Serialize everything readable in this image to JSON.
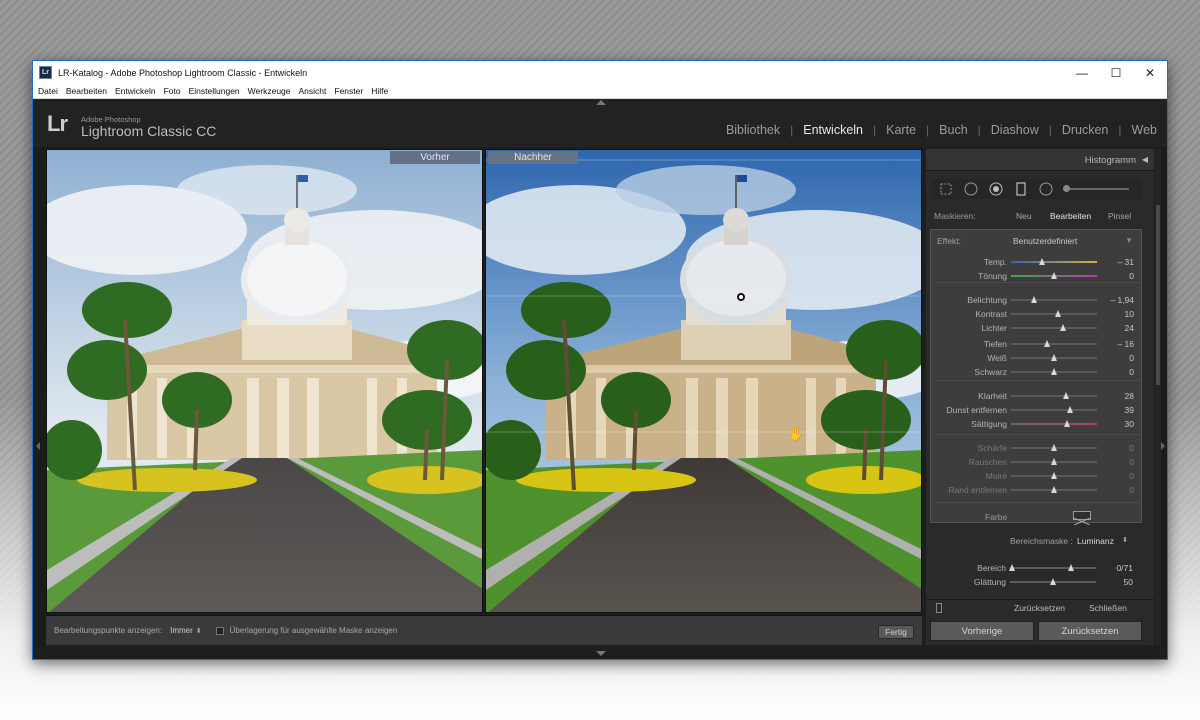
{
  "window": {
    "title": "LR-Katalog - Adobe Photoshop Lightroom Classic - Entwickeln",
    "icon_text": "Lr",
    "controls": {
      "minimize": "—",
      "maximize": "☐",
      "close": "✕"
    }
  },
  "menu": [
    "Datei",
    "Bearbeiten",
    "Entwickeln",
    "Foto",
    "Einstellungen",
    "Werkzeuge",
    "Ansicht",
    "Fenster",
    "Hilfe"
  ],
  "branding": {
    "logo": "Lr",
    "line1": "Adobe Photoshop",
    "line2": "Lightroom Classic CC"
  },
  "modules": [
    {
      "label": "Bibliothek",
      "active": false
    },
    {
      "label": "Entwickeln",
      "active": true
    },
    {
      "label": "Karte",
      "active": false
    },
    {
      "label": "Buch",
      "active": false
    },
    {
      "label": "Diashow",
      "active": false
    },
    {
      "label": "Drucken",
      "active": false
    },
    {
      "label": "Web",
      "active": false
    }
  ],
  "view": {
    "before_label": "Vorher",
    "after_label": "Nachher"
  },
  "toolbar": {
    "show_points_label": "Bearbeitungspunkte anzeigen:",
    "show_points_value": "Immer",
    "overlay_label": "Überlagerung für ausgewählte Maske anzeigen",
    "done_button": "Fertig"
  },
  "panel": {
    "histogram_title": "Histogramm",
    "mask": {
      "label": "Maskieren:",
      "new": "Neu",
      "edit": "Bearbeiten",
      "brush": "Pinsel"
    },
    "effect": {
      "label": "Effekt:",
      "value": "Benutzerdefiniert"
    },
    "sliders": [
      {
        "label": "Temp.",
        "value": "– 31",
        "pos": 0.36,
        "dim": false
      },
      {
        "label": "Tönung",
        "value": "0",
        "pos": 0.5,
        "dim": false
      },
      {
        "label": "Belichtung",
        "value": "– 1,94",
        "pos": 0.27,
        "dim": false
      },
      {
        "label": "Kontrast",
        "value": "10",
        "pos": 0.55,
        "dim": false
      },
      {
        "label": "Lichter",
        "value": "24",
        "pos": 0.61,
        "dim": false
      },
      {
        "label": "Tiefen",
        "value": "– 16",
        "pos": 0.42,
        "dim": false
      },
      {
        "label": "Weiß",
        "value": "0",
        "pos": 0.5,
        "dim": false
      },
      {
        "label": "Schwarz",
        "value": "0",
        "pos": 0.5,
        "dim": false
      },
      {
        "label": "Klarheit",
        "value": "28",
        "pos": 0.64,
        "dim": false
      },
      {
        "label": "Dunst entfernen",
        "value": "39",
        "pos": 0.69,
        "dim": false
      },
      {
        "label": "Sättigung",
        "value": "30",
        "pos": 0.65,
        "dim": false
      },
      {
        "label": "Schärfe",
        "value": "0",
        "pos": 0.5,
        "dim": true
      },
      {
        "label": "Rauschen",
        "value": "0",
        "pos": 0.5,
        "dim": true
      },
      {
        "label": "Moiré",
        "value": "0",
        "pos": 0.5,
        "dim": true
      },
      {
        "label": "Rand entfernen",
        "value": "0",
        "pos": 0.5,
        "dim": true
      }
    ],
    "color_label": "Farbe",
    "range_mask": {
      "label": "Bereichsmaske :",
      "value": "Luminanz",
      "range_label": "Bereich",
      "range_value": "0/71",
      "smooth_label": "Glättung",
      "smooth_value": "50",
      "smooth_pos": 0.5
    },
    "footer": {
      "reset": "Zurücksetzen",
      "close": "Schließen"
    },
    "buttons": {
      "previous": "Vorherige",
      "reset": "Zurücksetzen"
    }
  }
}
